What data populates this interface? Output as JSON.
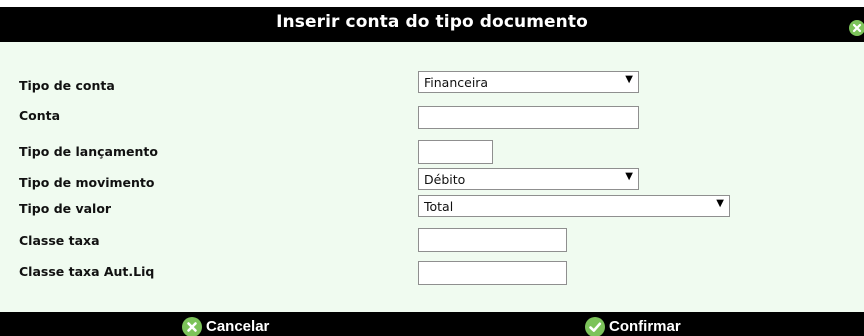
{
  "dialog": {
    "title": "Inserir conta do tipo documento",
    "close_icon": "close-icon"
  },
  "form": {
    "tipo_conta": {
      "label": "Tipo de conta",
      "value": "Financeira"
    },
    "conta": {
      "label": "Conta",
      "value": ""
    },
    "tipo_lancamento": {
      "label": "Tipo de lançamento",
      "value": ""
    },
    "tipo_movimento": {
      "label": "Tipo de movimento",
      "value": "Débito"
    },
    "tipo_valor": {
      "label": "Tipo de valor",
      "value": "Total"
    },
    "classe_taxa": {
      "label": "Classe taxa",
      "value": ""
    },
    "classe_taxa_aut": {
      "label": "Classe taxa Aut.Liq",
      "value": ""
    }
  },
  "footer": {
    "cancel_label": "Cancelar",
    "confirm_label": "Confirmar"
  },
  "colors": {
    "title_bar": "#000000",
    "body_bg": "#f0fbf0",
    "icon_green": "#7cc35a"
  },
  "icons": {
    "dropdown": "dropdown-arrow-icon",
    "cancel": "x-circle-icon",
    "confirm": "check-circle-icon"
  }
}
